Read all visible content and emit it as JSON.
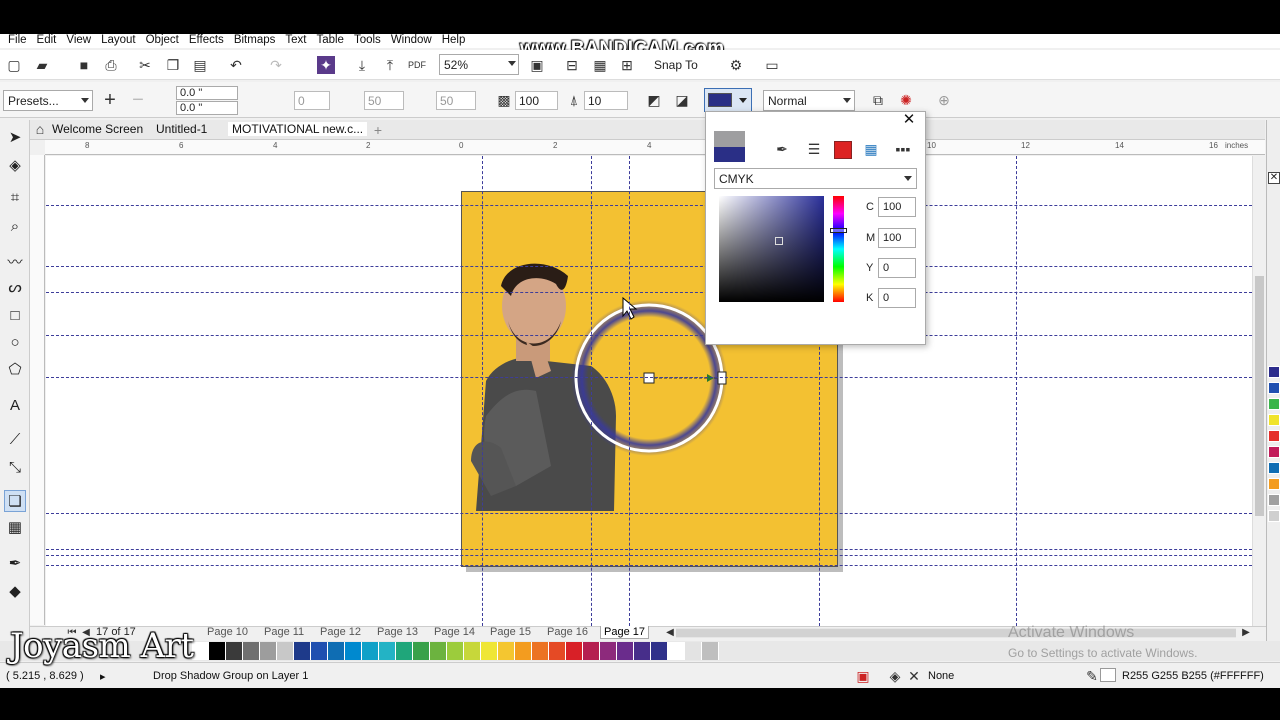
{
  "menu": [
    "File",
    "Edit",
    "View",
    "Layout",
    "Object",
    "Effects",
    "Bitmaps",
    "Text",
    "Table",
    "Tools",
    "Window",
    "Help"
  ],
  "watermark": "www.BANDICAM.com",
  "toolbar": {
    "zoom": "52%",
    "snap_to": "Snap To"
  },
  "property_bar": {
    "presets": "Presets...",
    "offset_x": "0.0 \"",
    "offset_y": "0.0 \"",
    "angle": "0",
    "stretch": "50",
    "fade": "50",
    "opacity": "100",
    "feather": "10",
    "blend_mode": "Normal",
    "shadow_color": "#2a2f86"
  },
  "doc_tabs": [
    "Welcome Screen",
    "Untitled-1",
    "MOTIVATIONAL new.c..."
  ],
  "ruler": {
    "units": "inches",
    "h_labels": [
      "8",
      "6",
      "4",
      "2",
      "0",
      "2",
      "4",
      "6",
      "8",
      "10",
      "12",
      "14",
      "16"
    ]
  },
  "color_popup": {
    "model": "CMYK",
    "C_label": "C",
    "C": "100",
    "M_label": "M",
    "M": "100",
    "Y_label": "Y",
    "Y": "0",
    "K_label": "K",
    "K": "0",
    "old_color": "#9e9ea0",
    "new_color": "#2a2f86"
  },
  "page_nav": {
    "counter": "17",
    "of": "of",
    "total": "17",
    "pages": [
      "Page 10",
      "Page 11",
      "Page 12",
      "Page 13",
      "Page 14",
      "Page 15",
      "Page 16",
      "Page 17"
    ],
    "active": "Page 17"
  },
  "status": {
    "coords": "( 5.215 , 8.629 )",
    "message": "Drop Shadow Group on Layer 1",
    "outline": "None",
    "fill_info": "R255 G255 B255 (#FFFFFF)"
  },
  "overlay": {
    "logo": "Joyasm Art",
    "activate_title": "Activate Windows",
    "activate_sub": "Go to Settings to activate Windows."
  },
  "palette_colors": [
    "#ffffff",
    "#000000",
    "#3a3a3a",
    "#707070",
    "#9d9d9d",
    "#c8c8c8",
    "#1e3a8a",
    "#1f4fb0",
    "#0f6db3",
    "#0089cf",
    "#0fa1c8",
    "#23b3c5",
    "#1fa67a",
    "#38a14a",
    "#6cb33f",
    "#9ccc3c",
    "#c7d73a",
    "#efe635",
    "#f4c630",
    "#f39c1f",
    "#ec7323",
    "#e54a25",
    "#d82027",
    "#b51f50",
    "#8d2a7c",
    "#6a2c8c",
    "#472e8a",
    "#2f318a",
    "#ffffff",
    "#e3e3e3",
    "#bfbfbf"
  ],
  "right_palette": [
    "#2c2c8c",
    "#1f4fb0",
    "#3ab54a",
    "#f0e32a",
    "#e52f2a",
    "#c21c5a",
    "#0f6db3",
    "#f39c1f",
    "#a0a0a0",
    "#cfcfcf"
  ]
}
